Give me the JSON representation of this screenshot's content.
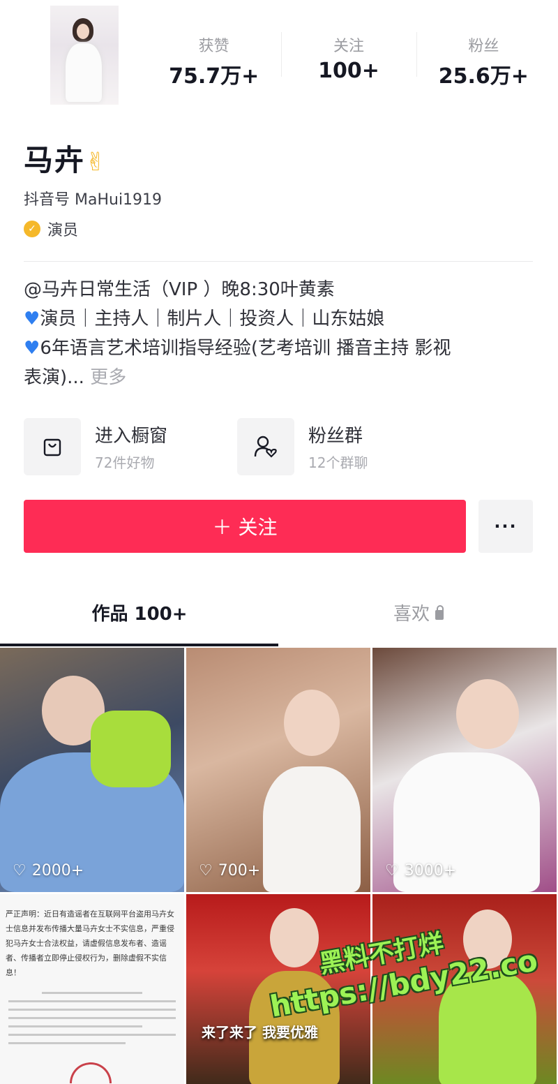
{
  "profile": {
    "name": "马卉",
    "name_emoji": "✌",
    "douyin_id": "抖音号 MaHui1919",
    "verify_label": "演员",
    "bio_line1": "@马卉日常生活（VIP ）晚8:30叶黄素",
    "bio_line2": "演员｜主持人｜制片人｜投资人｜山东姑娘",
    "bio_line3": "6年语言艺术培训指导经验(艺考培训 播音主持 影视",
    "bio_line4": "表演)...",
    "bio_more": "更多"
  },
  "stats": [
    {
      "label": "获赞",
      "value": "75.7万+"
    },
    {
      "label": "关注",
      "value": "100+"
    },
    {
      "label": "粉丝",
      "value": "25.6万+"
    }
  ],
  "actions": {
    "shop_title": "进入橱窗",
    "shop_sub": "72件好物",
    "fans_title": "粉丝群",
    "fans_sub": "12个群聊"
  },
  "buttons": {
    "follow_label": "＋ 关注",
    "more_label": "···"
  },
  "tabs": {
    "works_label": "作品 100+",
    "likes_label": "喜欢"
  },
  "videos": [
    {
      "likes": "2000+"
    },
    {
      "likes": "700+"
    },
    {
      "likes": "3000+"
    }
  ],
  "notice": {
    "text": "严正声明：近日有造谣者在互联网平台盗用马卉女士信息并发布传播大量马卉女士不实信息，严重侵犯马卉女士合法权益，请虚假信息发布者、造谣者、传播者立即停止侵权行为，删除虚假不实信息！"
  },
  "video5_caption": "来了来了 我要优雅",
  "watermark": {
    "line1": "黑料不打烊",
    "line2": "https://bdy22.co"
  },
  "colors": {
    "accent": "#fe2c55",
    "verify": "#f5b82a",
    "heart_emoji": "#2f7ff0"
  }
}
